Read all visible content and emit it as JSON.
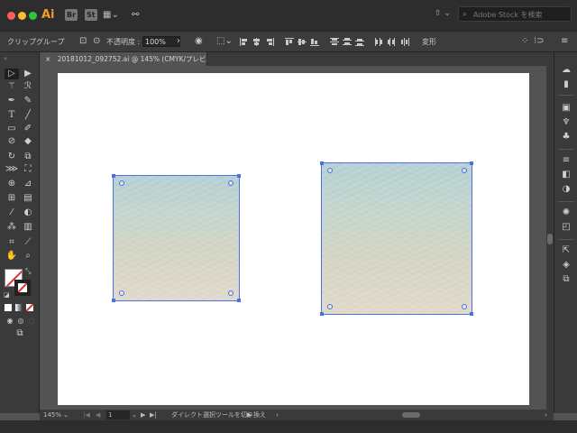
{
  "app": {
    "logo": "Ai",
    "buttons": [
      "Br",
      "St"
    ],
    "arrange_label": "⇧ ⌄",
    "stock_search_placeholder": "Adobe Stock を検索"
  },
  "controlbar": {
    "selection_label": "クリップグループ",
    "opacity_label": "不透明度 :",
    "opacity_value": "100%",
    "transform_label": "変形"
  },
  "document": {
    "tab_title": "20181012_092752.ai @ 145% (CMYK/プレビュー)",
    "close_glyph": "×"
  },
  "statusbar": {
    "zoom": "145%",
    "artboard_number": "1",
    "status_text": "ダイレクト選択ツールを切り換え"
  },
  "colors": {
    "selection": "#4a6fe8",
    "app_bg": "#535353",
    "panel_bg": "#3a3a3a"
  },
  "tools": [
    "selection-tool",
    "direct-selection-tool",
    "magic-wand-tool",
    "lasso-tool",
    "pen-tool",
    "curvature-tool",
    "type-tool",
    "line-tool",
    "rectangle-tool",
    "paintbrush-tool",
    "shaper-tool",
    "eraser-tool",
    "rotate-tool",
    "scale-tool",
    "width-tool",
    "free-transform-tool",
    "shape-builder-tool",
    "perspective-grid-tool",
    "mesh-tool",
    "gradient-tool",
    "eyedropper-tool",
    "blend-tool",
    "symbol-sprayer-tool",
    "column-graph-tool",
    "artboard-tool",
    "slice-tool",
    "hand-tool",
    "zoom-tool"
  ]
}
